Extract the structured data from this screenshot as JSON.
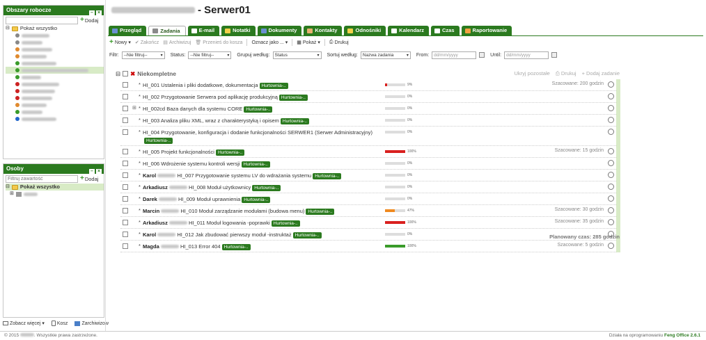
{
  "workspaces": {
    "title": "Obszary robocze",
    "add_label": "Dodaj",
    "show_all": "Pokaż wszystko",
    "items": [
      {
        "color": "#888888",
        "w": 40
      },
      {
        "color": "#888888",
        "w": 30
      },
      {
        "color": "#e08a2e",
        "w": 44
      },
      {
        "color": "#e08a2e",
        "w": 36
      },
      {
        "color": "#3a9b2a",
        "w": 50
      },
      {
        "color": "#3a9b2a",
        "w": 96,
        "selected": true
      },
      {
        "color": "#3a9b2a",
        "w": 28
      },
      {
        "color": "#cc2222",
        "w": 54
      },
      {
        "color": "#cc2222",
        "w": 48
      },
      {
        "color": "#cc2222",
        "w": 44
      },
      {
        "color": "#e08a2e",
        "w": 36
      },
      {
        "color": "#3a9b2a",
        "w": 30
      },
      {
        "color": "#2266cc",
        "w": 50
      }
    ]
  },
  "people": {
    "title": "Osoby",
    "filter_placeholder": "Filtruj zawartość",
    "add_label": "Dodaj",
    "show_all": "Pokaż wszystko"
  },
  "bottom": {
    "more": "Zobacz więcej",
    "trash": "Kosz",
    "archived": "Zarchiwizow"
  },
  "page_title": "- Serwer01",
  "tabs": [
    {
      "label": "Przegląd",
      "color": "#6a8fd0"
    },
    {
      "label": "Zadania",
      "color": "#8a8a8a",
      "active": true
    },
    {
      "label": "E-mail",
      "color": "#ffffff"
    },
    {
      "label": "Notatki",
      "color": "#f3d04a"
    },
    {
      "label": "Dokumenty",
      "color": "#6a8fd0"
    },
    {
      "label": "Kontakty",
      "color": "#e8b070"
    },
    {
      "label": "Odnośniki",
      "color": "#f3d04a"
    },
    {
      "label": "Kalendarz",
      "color": "#ffffff"
    },
    {
      "label": "Czas",
      "color": "#ffffff"
    },
    {
      "label": "Raportowanie",
      "color": "#f3a040"
    }
  ],
  "toolbar": {
    "new": "Nowy",
    "complete": "Zakończ",
    "archive": "Archiwizuj",
    "move": "Przenieś do kosza",
    "mark": "Oznacz jako ...",
    "show": "Pokaż",
    "print": "Drukuj"
  },
  "filters": {
    "filter_label": "Filtr:",
    "filter_value": "--Nie filtruj--",
    "status_label": "Status:",
    "status_value": "--Nie filtruj--",
    "group_label": "Grupuj według:",
    "group_value": "Status",
    "sort_label": "Sortuj według:",
    "sort_value": "Nazwa zadania",
    "from_label": "From:",
    "to_label": "Until:",
    "date_placeholder": "dd/mm/yyyy"
  },
  "group": {
    "name": "Niekompletne",
    "hide": "Ukryj pozostałe",
    "print": "Drukuj",
    "add": "Dodaj zadanie"
  },
  "tasks": [
    {
      "user": "",
      "title": "HI_001 Ustalenia i pliki dodatkowe, dokumentacja",
      "tag": "Hurtownia-..",
      "pct": "9%",
      "p": 9,
      "color": "#d9201f",
      "est": "Szacowane: 200 godzin"
    },
    {
      "user": "",
      "title": "HI_002 Przygotowanie Serwera pod aplikację produkcyjną",
      "tag": "Hurtownia-..",
      "pct": "0%",
      "p": 0,
      "color": "#d9201f",
      "est": ""
    },
    {
      "user": "",
      "title": "HI_002cd Baza danych dla systemu CORE",
      "tag": "Hurtownia-..",
      "pct": "0%",
      "p": 0,
      "color": "#d9201f",
      "est": "",
      "expand": true
    },
    {
      "user": "",
      "title": "HI_003 Analiza pliku XML, wraz z charakterystyką i opisem",
      "tag": "Hurtownia-..",
      "pct": "0%",
      "p": 0,
      "color": "#d9201f",
      "est": ""
    },
    {
      "user": "",
      "title": "HI_004 Przygotowanie, konfiguracja i dodanie funkcjonalności SERWER1 (Serwer Administracyjny)",
      "tag": "Hurtownia-..",
      "pct": "0%",
      "p": 0,
      "color": "#d9201f",
      "est": ""
    },
    {
      "user": "",
      "title": "HI_005 Projekt funkcjonalności",
      "tag": "Hurtownia-..",
      "pct": "100%",
      "p": 100,
      "color": "#d9201f",
      "est": "Szacowane: 15 godzin"
    },
    {
      "user": "",
      "title": "HI_006 Wdrożenie systemu kontroli wersji",
      "tag": "Hurtownia-..",
      "pct": "0%",
      "p": 0,
      "color": "#d9201f",
      "est": ""
    },
    {
      "user": "Karol",
      "title": "HI_007 Przygotowanie systemu LV do wdrażania systemu",
      "tag": "Hurtownia-..",
      "pct": "0%",
      "p": 0,
      "color": "#d9201f",
      "est": ""
    },
    {
      "user": "Arkadiusz",
      "title": "HI_008 Moduł użytkownicy",
      "tag": "Hurtownia-..",
      "pct": "0%",
      "p": 0,
      "color": "#d9201f",
      "est": ""
    },
    {
      "user": "Darek",
      "title": "HI_009 Moduł uprawnienia",
      "tag": "Hurtownia-..",
      "pct": "0%",
      "p": 0,
      "color": "#d9201f",
      "est": ""
    },
    {
      "user": "Marcin",
      "title": "HI_010 Moduł zarządzanie modułami (budowa menu)",
      "tag": "Hurtownia-..",
      "pct": "47%",
      "p": 47,
      "color": "#f08a20",
      "est": "Szacowane: 30 godzin"
    },
    {
      "user": "Arkadiusz",
      "title": "HI_011 Moduł logowania -poprawki",
      "tag": "Hurtownia-..",
      "pct": "100%",
      "p": 100,
      "color": "#d9201f",
      "est": "Szacowane: 35 godzin"
    },
    {
      "user": "Karol",
      "title": "HI_012 Jak zbudować pierwszy moduł -instruktaż",
      "tag": "Hurtownia-..",
      "pct": "0%",
      "p": 0,
      "color": "#d9201f",
      "est": ""
    },
    {
      "user": "Magda",
      "title": "HI_013 Error 404",
      "tag": "Hurtownia-..",
      "pct": "100%",
      "p": 100,
      "color": "#3a9b2a",
      "est": "Szacowane: 5 godzin"
    }
  ],
  "total": "Planowany czas: 285 godzin",
  "footer": {
    "copyright_prefix": "© 2015",
    "copyright_suffix": "Wszystkie prawa zastrzeżone.",
    "powered": "Działa na oprogramowaniu",
    "product": "Feng Office 2.6.1"
  }
}
